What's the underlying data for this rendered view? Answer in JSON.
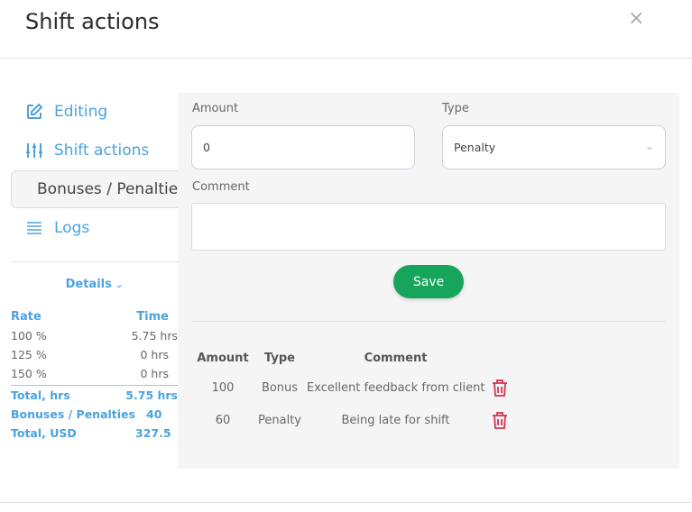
{
  "header": {
    "title": "Shift actions",
    "close": "×"
  },
  "sidebar": {
    "items": [
      {
        "label": "Editing",
        "icon": "edit-icon"
      },
      {
        "label": "Shift actions",
        "icon": "sliders-icon"
      },
      {
        "label": "Bonuses / Penalties",
        "icon": "smile-icon",
        "active": true
      },
      {
        "label": "Logs",
        "icon": "list-icon"
      }
    ],
    "details_label": "Details",
    "stats": {
      "headers": [
        "Rate",
        "Time"
      ],
      "rows": [
        [
          "100 %",
          "5.75 hrs"
        ],
        [
          "125 %",
          "0 hrs"
        ],
        [
          "150 %",
          "0 hrs"
        ]
      ],
      "totals": [
        [
          "Total, hrs",
          "5.75 hrs"
        ],
        [
          "Bonuses / Penalties",
          "40"
        ],
        [
          "Total, USD",
          "327.5"
        ]
      ]
    }
  },
  "form": {
    "amount_label": "Amount",
    "amount_value": "0",
    "type_label": "Type",
    "type_value": "Penalty",
    "comment_label": "Comment",
    "comment_value": "",
    "save_label": "Save"
  },
  "table": {
    "headers": [
      "Amount",
      "Type",
      "Comment"
    ],
    "rows": [
      {
        "amount": "100",
        "type": "Bonus",
        "comment": "Excellent feedback from client"
      },
      {
        "amount": "60",
        "type": "Penalty",
        "comment": "Being late for shift"
      }
    ]
  },
  "colors": {
    "accent": "#4aa3df",
    "save": "#17a45b",
    "delete": "#d9304f",
    "grammarly": "#15c39a"
  }
}
